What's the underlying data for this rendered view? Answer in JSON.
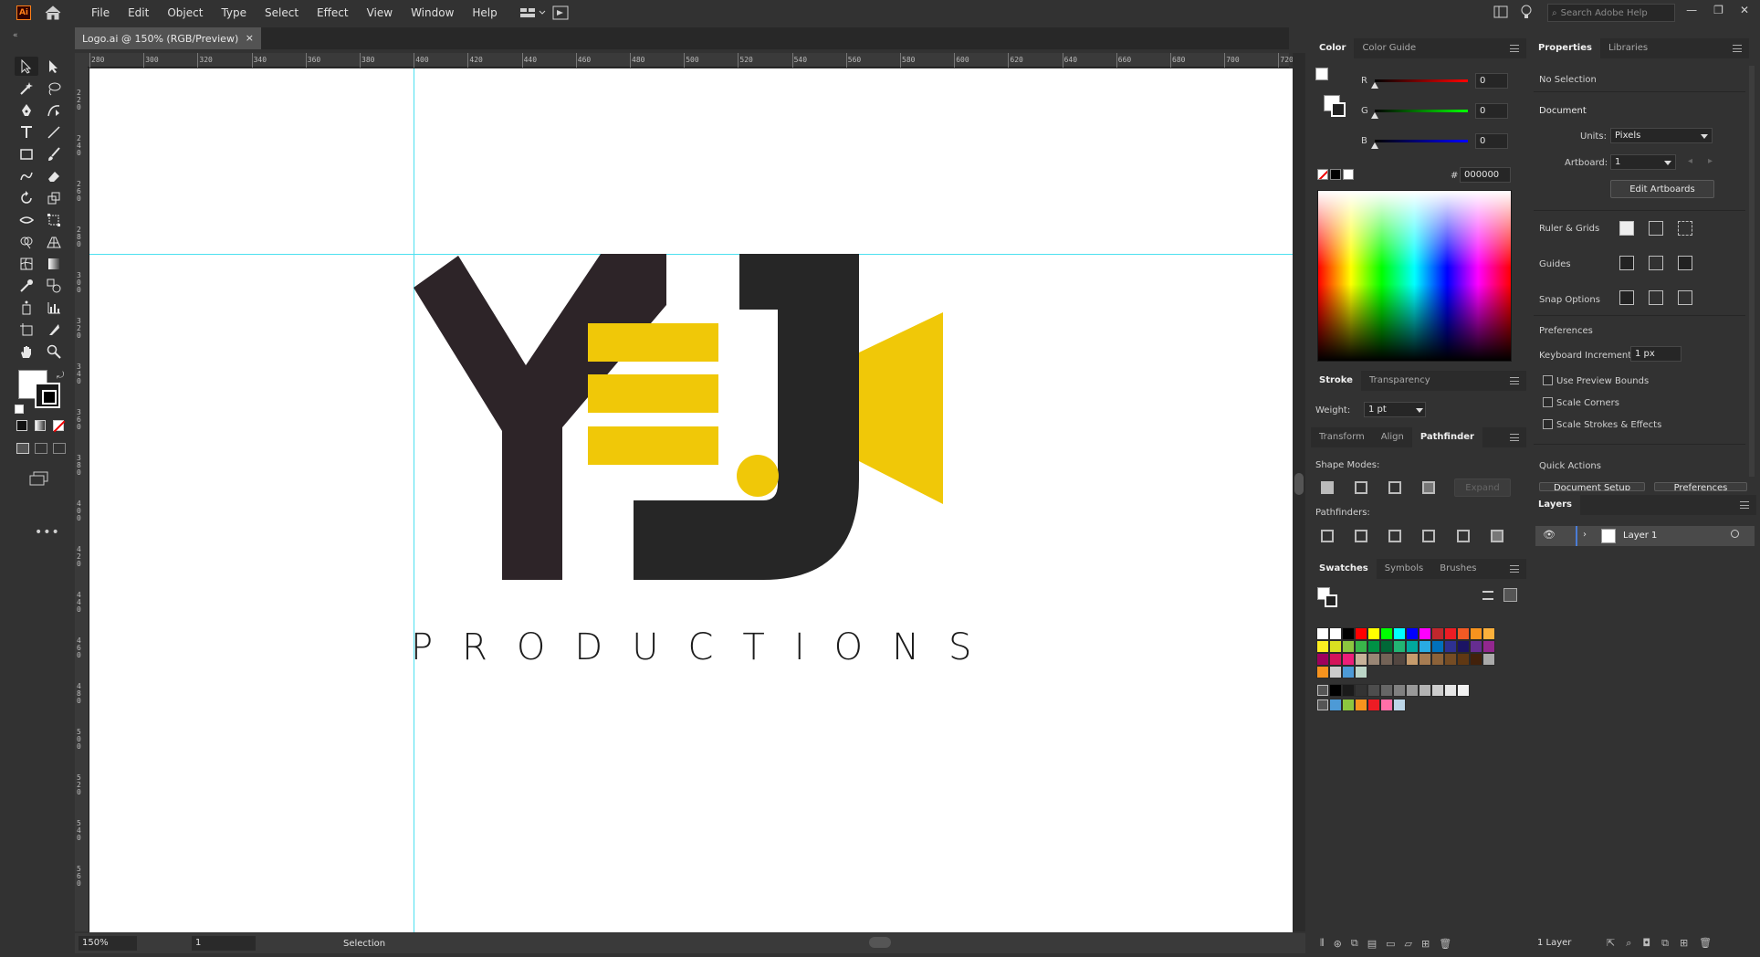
{
  "app": {
    "logo": "Ai",
    "search_placeholder": "Search Adobe Help"
  },
  "menu": [
    "File",
    "Edit",
    "Object",
    "Type",
    "Select",
    "Effect",
    "View",
    "Window",
    "Help"
  ],
  "document": {
    "tab_title": "Logo.ai @ 150% (RGB/Preview)",
    "close": "×"
  },
  "ruler": {
    "h_labels": [
      "280",
      "300",
      "320",
      "340",
      "360",
      "380",
      "400",
      "420",
      "440",
      "460",
      "480",
      "500",
      "520",
      "540",
      "560",
      "580",
      "600",
      "620",
      "640",
      "660",
      "680",
      "700",
      "720"
    ],
    "v_labels": [
      "220",
      "240",
      "260",
      "280",
      "300",
      "320",
      "340",
      "360",
      "380",
      "400",
      "420",
      "440",
      "460",
      "480",
      "500",
      "520",
      "540",
      "560"
    ]
  },
  "artwork": {
    "tagline": "PRODUCTIONS",
    "colors": {
      "dark": "#2d2428",
      "dark2": "#262626",
      "yellow": "#f0c808"
    }
  },
  "statusbar": {
    "zoom": "150%",
    "page": "1",
    "mode": "Selection"
  },
  "color_panel": {
    "tabs": [
      "Color",
      "Color Guide"
    ],
    "r_label": "R",
    "r_value": "0",
    "g_label": "G",
    "g_value": "0",
    "b_label": "B",
    "b_value": "0",
    "hex_label": "#",
    "hex_value": "000000"
  },
  "stroke_panel": {
    "tabs": [
      "Stroke",
      "Transparency"
    ],
    "weight_label": "Weight:",
    "weight_value": "1 pt"
  },
  "pathfinder_panel": {
    "tabs": [
      "Transform",
      "Align",
      "Pathfinder"
    ],
    "shape_modes": "Shape Modes:",
    "expand": "Expand",
    "pathfinders": "Pathfinders:"
  },
  "swatches_panel": {
    "tabs": [
      "Swatches",
      "Symbols",
      "Brushes"
    ]
  },
  "properties_panel": {
    "tabs": [
      "Properties",
      "Libraries"
    ],
    "no_selection": "No Selection",
    "document": "Document",
    "units_label": "Units:",
    "units_value": "Pixels",
    "artboard_label": "Artboard:",
    "artboard_value": "1",
    "edit_artboards": "Edit Artboards",
    "ruler_grids": "Ruler & Grids",
    "guides": "Guides",
    "snap_options": "Snap Options",
    "preferences": "Preferences",
    "keyboard_increment_label": "Keyboard Increment:",
    "keyboard_increment_value": "1 px",
    "use_preview_bounds": "Use Preview Bounds",
    "scale_corners": "Scale Corners",
    "scale_strokes": "Scale Strokes & Effects",
    "quick_actions": "Quick Actions",
    "document_setup": "Document Setup",
    "preferences_btn": "Preferences"
  },
  "layers_panel": {
    "tab": "Layers",
    "layer_name": "Layer 1",
    "footer": "1 Layer"
  },
  "swatch_colors": [
    [
      "#ffffff",
      "#ffffff",
      "#000000",
      "#ff0000",
      "#ffff00",
      "#00ff00",
      "#00ffff",
      "#0000ff",
      "#ff00ff",
      "#c1272d",
      "#ed1c24",
      "#f15a24",
      "#f7931e",
      "#fbb03b"
    ],
    [
      "#fcee21",
      "#d9e021",
      "#8cc63f",
      "#39b54a",
      "#009245",
      "#006837",
      "#22b573",
      "#00a99d",
      "#29abe2",
      "#0071bc",
      "#2e3192",
      "#1b1464",
      "#662d91",
      "#93278f"
    ],
    [
      "#9e005d",
      "#d4145a",
      "#ed1e79",
      "#c7b299",
      "#998675",
      "#736357",
      "#534741",
      "#c69c6d",
      "#a67c52",
      "#8c6239",
      "#754c24",
      "#603813",
      "#42210b",
      "#aaaaaa"
    ],
    [
      "#f7931e",
      "#cccccc",
      "#4d9ad6",
      "#bcd6c8"
    ],
    [
      "#000000",
      "#1a1a1a",
      "#333333",
      "#4d4d4d",
      "#666666",
      "#808080",
      "#999999",
      "#b3b3b3",
      "#cccccc",
      "#e6e6e6",
      "#f2f2f2"
    ],
    [
      "#4d9ad6",
      "#8cc63f",
      "#f7931e",
      "#ed1c24",
      "#ff6fa8",
      "#bcd6e8"
    ]
  ]
}
